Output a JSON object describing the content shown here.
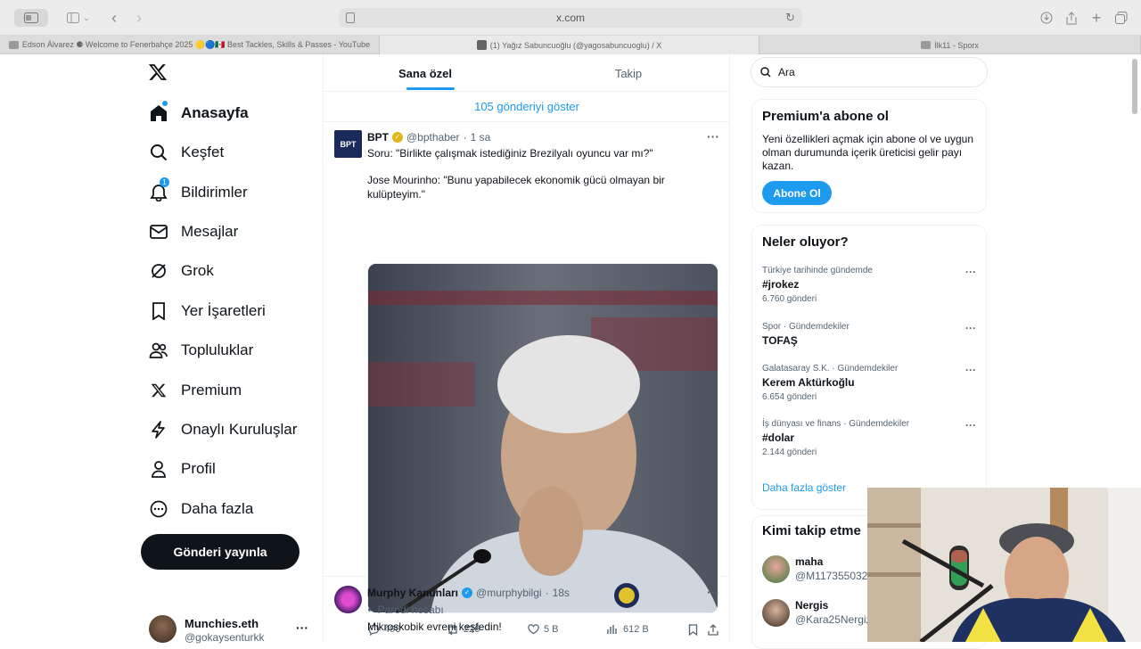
{
  "browser": {
    "url": "x.com",
    "tabs": [
      {
        "title": "Edson Álvarez ⚈ Welcome to Fenerbahçe 2025 🟡🔵🇲🇽 Best Tackles, Skills & Passes - YouTube",
        "favicon_color": "#9a9a9a",
        "active": false
      },
      {
        "title": "(1) Yağız Sabuncuoğlu (@yagosabuncuoglu) / X",
        "favicon_color": "#666666",
        "active": true
      },
      {
        "title": "İlk11 - Sporx",
        "favicon_color": "#9a9a9a",
        "active": false
      }
    ]
  },
  "sidebar": {
    "items": [
      {
        "label": "Anasayfa",
        "icon": "home-icon",
        "bold": true
      },
      {
        "label": "Keşfet",
        "icon": "search-icon"
      },
      {
        "label": "Bildirimler",
        "icon": "bell-icon",
        "badge": "1"
      },
      {
        "label": "Mesajlar",
        "icon": "envelope-icon"
      },
      {
        "label": "Grok",
        "icon": "grok-icon"
      },
      {
        "label": "Yer İşaretleri",
        "icon": "bookmark-icon"
      },
      {
        "label": "Topluluklar",
        "icon": "communities-icon"
      },
      {
        "label": "Premium",
        "icon": "x-logo-icon"
      },
      {
        "label": "Onaylı Kuruluşlar",
        "icon": "lightning-icon"
      },
      {
        "label": "Profil",
        "icon": "person-icon"
      },
      {
        "label": "Daha fazla",
        "icon": "more-circle-icon"
      }
    ],
    "post_button": "Gönderi yayınla",
    "account": {
      "name": "Munchies.eth",
      "handle": "@gokaysenturkk"
    }
  },
  "feed": {
    "tabs": [
      "Sana özel",
      "Takip"
    ],
    "show_more": "105 gönderiyi göster",
    "tweets": [
      {
        "avatar_text": "BPT",
        "name": "BPT",
        "handle": "@bpthaber",
        "time": "1 sa",
        "line1": "Soru: \"Birlikte çalışmak istediğiniz Brezilyalı oyuncu var mı?\"",
        "line2": "Jose Mourinho: \"Bunu yapabilecek ekonomik gücü olmayan bir kulüpteyim.\"",
        "replies": "490",
        "reposts": "226",
        "likes": "5 B",
        "views": "612 B"
      },
      {
        "name": "Murphy Kanunları",
        "handle": "@murphybilgi",
        "time": "18s",
        "label": "Parodi hesabı",
        "text": "Mikroskobik evreni keşfedin!"
      }
    ]
  },
  "right": {
    "search_placeholder": "Ara",
    "premium": {
      "title": "Premium'a abone ol",
      "desc": "Yeni özellikleri açmak için abone ol ve uygun olman durumunda içerik üreticisi gelir payı kazan.",
      "button": "Abone Ol"
    },
    "trends_title": "Neler oluyor?",
    "trends": [
      {
        "context": "Türkiye tarihinde gündemde",
        "topic": "#jrokez",
        "count": "6.760 gönderi"
      },
      {
        "context": "Spor · Gündemdekiler",
        "topic": "TOFAŞ",
        "count": ""
      },
      {
        "context": "Galatasaray S.K. · Gündemdekiler",
        "topic": "Kerem Aktürkoğlu",
        "count": "6.654 gönderi"
      },
      {
        "context": "İş dünyası ve finans · Gündemdekiler",
        "topic": "#dolar",
        "count": "2.144 gönderi"
      }
    ],
    "show_more_trends": "Daha fazla göster",
    "who_title": "Kimi takip etme",
    "who": [
      {
        "name": "maha",
        "handle": "@M1173550329"
      },
      {
        "name": "Nergis",
        "handle": "@Kara25Nergiz"
      }
    ]
  },
  "colors": {
    "accent": "#1d9bf0",
    "text": "#0f1419",
    "muted": "#536471",
    "verified_gold": "#e2b719"
  }
}
